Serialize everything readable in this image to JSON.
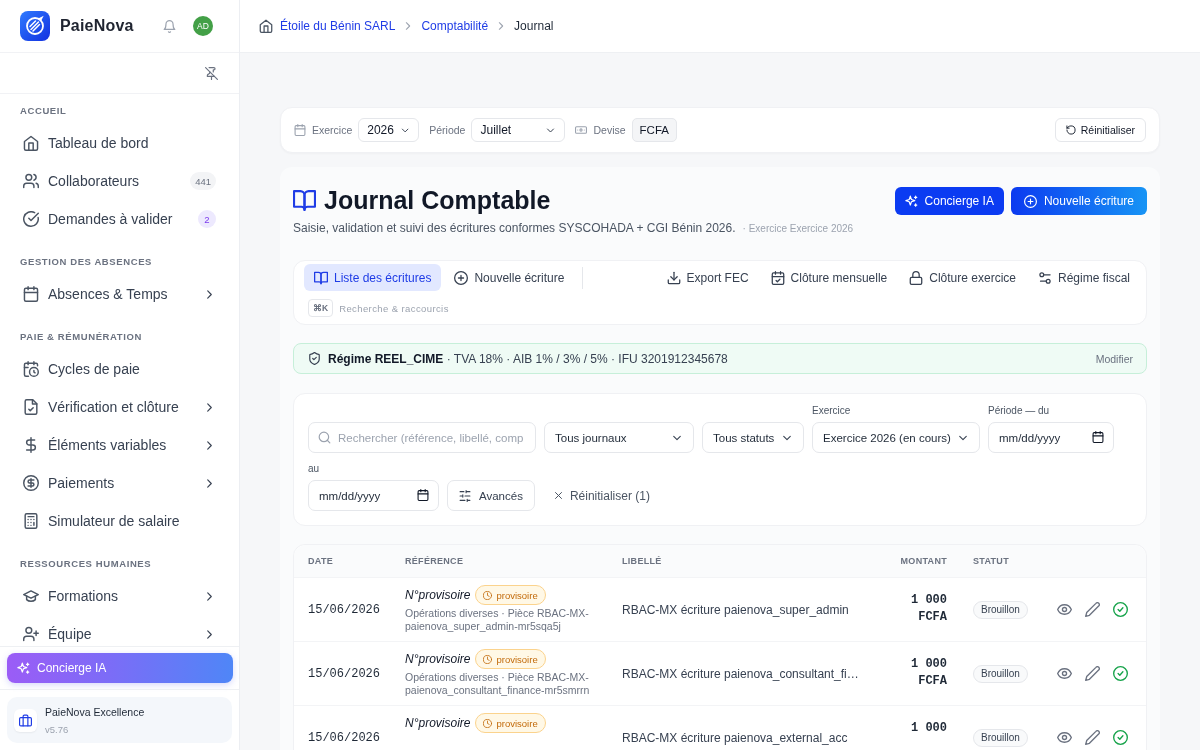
{
  "sidebar": {
    "brand": "PaieNova",
    "avatar": "AD",
    "sections": [
      {
        "title": "ACCUEIL",
        "items": [
          {
            "label": "Tableau de bord",
            "selected": false,
            "expandable": false
          },
          {
            "label": "Collaborateurs",
            "badge": "441",
            "badge_accent": false,
            "selected": false,
            "expandable": false
          },
          {
            "label": "Demandes à valider",
            "badge": "2",
            "badge_accent": true,
            "selected": false,
            "expandable": false
          }
        ]
      },
      {
        "title": "GESTION DES ABSENCES",
        "items": [
          {
            "label": "Absences & Temps",
            "selected": false,
            "expandable": true
          }
        ]
      },
      {
        "title": "PAIE & RÉMUNÉRATION",
        "items": [
          {
            "label": "Cycles de paie",
            "selected": false,
            "expandable": false
          },
          {
            "label": "Vérification et clôture",
            "selected": false,
            "expandable": true
          },
          {
            "label": "Éléments variables",
            "selected": false,
            "expandable": true
          },
          {
            "label": "Paiements",
            "selected": false,
            "expandable": true
          },
          {
            "label": "Simulateur de salaire",
            "selected": false,
            "expandable": false
          }
        ]
      },
      {
        "title": "RESSOURCES HUMAINES",
        "items": [
          {
            "label": "Formations",
            "selected": false,
            "expandable": true
          },
          {
            "label": "Équipe",
            "selected": false,
            "expandable": true
          }
        ]
      }
    ],
    "assistant_button": "Concierge IA",
    "plan": {
      "name": "PaieNova Excellence",
      "version": "v5.76"
    }
  },
  "breadcrumb": [
    {
      "label": "Étoile du Bénin SARL",
      "kind": "link"
    },
    {
      "label": "Comptabilité",
      "kind": "link"
    },
    {
      "label": "Journal",
      "kind": "current"
    }
  ],
  "context_bar": {
    "fields": [
      {
        "label": "Exercice",
        "value": "2026",
        "kind": "select"
      },
      {
        "label": "Période",
        "value": "Juillet",
        "kind": "select"
      },
      {
        "label": "Devise",
        "value": "FCFA",
        "kind": "readonly"
      }
    ],
    "reset_button": "Réinitialiser"
  },
  "page": {
    "title": "Journal Comptable",
    "subtitle": "Saisie, validation et suivi des écritures conformes SYSCOHADA + CGI Bénin 2026.",
    "note": "· Exercice Exercice 2026",
    "buttons": [
      {
        "label": "Concierge IA",
        "kind": "assistant"
      },
      {
        "label": "Nouvelle écriture",
        "kind": "primary"
      }
    ]
  },
  "toolbar": {
    "tabs": [
      {
        "label": "Liste des écritures",
        "selected": true
      },
      {
        "label": "Nouvelle écriture",
        "selected": false
      }
    ],
    "actions": [
      "Export FEC",
      "Clôture mensuelle",
      "Clôture exercice",
      "Régime fiscal"
    ],
    "shortcut": {
      "key": "⌘K",
      "hint": "Recherche & raccourcis"
    }
  },
  "regime_banner": {
    "text": "**Régime REEL_CIME** · TVA 18% · AIB 1% / 3% / 5% · IFU 3201912345678",
    "link": "Modifier"
  },
  "filters": [
    {
      "kind": "search",
      "placeholder": "Rechercher (référence, libellé, comp"
    },
    {
      "kind": "select",
      "value": "Tous journaux"
    },
    {
      "kind": "select",
      "value": "Tous statuts"
    },
    {
      "kind": "select",
      "label": "Exercice",
      "value": "Exercice 2026 (en cours)"
    },
    {
      "kind": "date",
      "label": "Période — du",
      "placeholder": "mm/dd/yyyy"
    },
    {
      "kind": "date",
      "label": "au",
      "placeholder": "mm/dd/yyyy"
    },
    {
      "kind": "button",
      "text": "Avancés"
    },
    {
      "kind": "clear",
      "text": "Réinitialiser (1)"
    }
  ],
  "table": {
    "columns": [
      "DATE",
      "RÉFÉRENCE",
      "LIBELLÉ",
      "MONTANT",
      "STATUT"
    ],
    "rows": [
      {
        "date": "15/06/2026",
        "reference": "N°provisoire",
        "badge": "provisoire",
        "detail": "Opérations diverses · Pièce RBAC-MX-paienova_super_admin-mr5sqa5j",
        "label": "RBAC-MX écriture paienova_super_admin",
        "amount": "1 000 FCFA",
        "status": "Brouillon"
      },
      {
        "date": "15/06/2026",
        "reference": "N°provisoire",
        "badge": "provisoire",
        "detail": "Opérations diverses · Pièce RBAC-MX-paienova_consultant_finance-mr5smrrn",
        "label": "RBAC-MX écriture paienova_consultant_fi…",
        "amount": "1 000 FCFA",
        "status": "Brouillon"
      },
      {
        "date": "15/06/2026",
        "reference": "N°provisoire",
        "badge": "provisoire",
        "label": "RBAC-MX écriture paienova_external_acc",
        "amount": "1 000",
        "status": "Brouillon"
      }
    ]
  }
}
